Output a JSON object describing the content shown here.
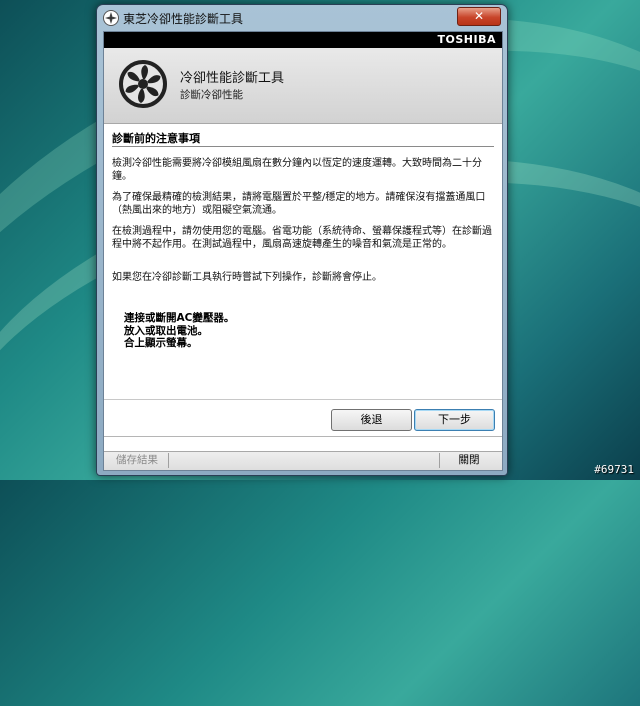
{
  "window": {
    "title": "東芝冷卻性能診斷工具",
    "close_symbol": "✕"
  },
  "brand": "TOSHIBA",
  "header": {
    "title": "冷卻性能診斷工具",
    "subtitle": "診斷冷卻性能"
  },
  "notice": {
    "title": "診斷前的注意事項",
    "paragraphs": [
      "檢測冷卻性能需要將冷卻模組風扇在數分鐘內以恆定的速度運轉。大致時間為二十分鐘。",
      "為了確保最精確的檢測結果，請將電腦置於平整/穩定的地方。請確保沒有擋蓋通風口（熱風出來的地方）或阻礙空氣流通。",
      "在檢測過程中，請勿使用您的電腦。省電功能（系統待命、螢幕保護程式等）在診斷過程中將不起作用。在測試過程中，風扇高速旋轉產生的噪音和氣流是正常的。",
      "如果您在冷卻診斷工具執行時嘗試下列操作，診斷將會停止。"
    ],
    "actions": [
      "連接或斷開AC變壓器。",
      "放入或取出電池。",
      "合上顯示螢幕。"
    ]
  },
  "buttons": {
    "back": "後退",
    "next": "下一步"
  },
  "statusbar": {
    "save": "儲存結果",
    "close": "關閉"
  },
  "corner_id": "#69731"
}
